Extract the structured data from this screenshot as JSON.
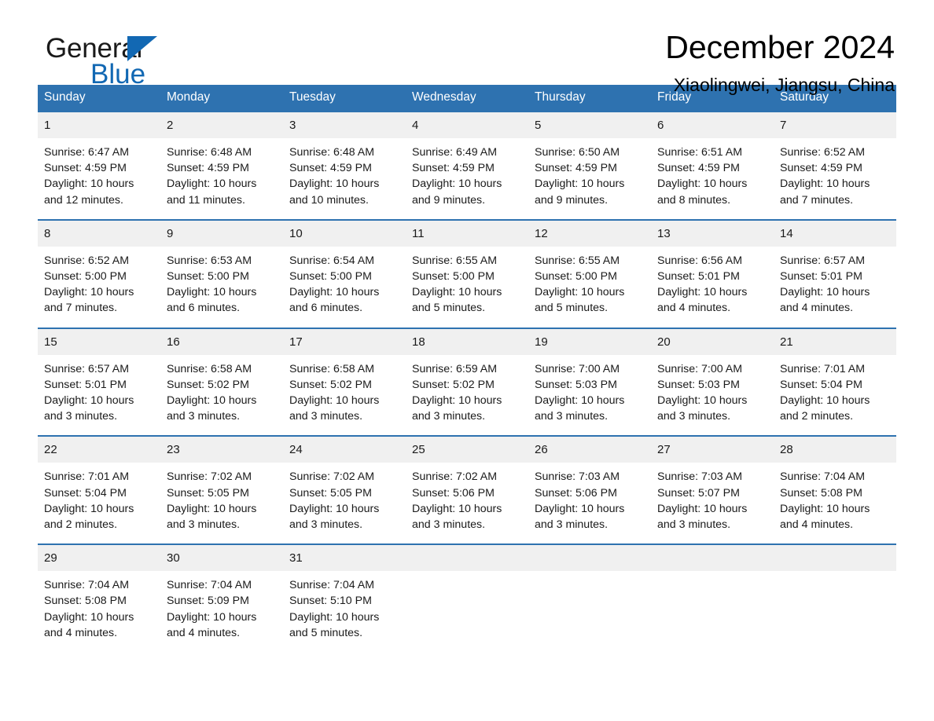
{
  "brand": {
    "name_part1": "General",
    "name_part2": "Blue",
    "logo_icon": "blue-triangle-icon",
    "accent_color": "#1268b3"
  },
  "header": {
    "title": "December 2024",
    "subtitle": "Xiaolingwei, Jiangsu, China"
  },
  "calendar": {
    "header_bg": "#2e72b0",
    "daynum_bg": "#f0f0f0",
    "weekday_headers": [
      "Sunday",
      "Monday",
      "Tuesday",
      "Wednesday",
      "Thursday",
      "Friday",
      "Saturday"
    ],
    "weeks": [
      [
        {
          "day": "1",
          "sunrise": "Sunrise: 6:47 AM",
          "sunset": "Sunset: 4:59 PM",
          "daylight_line1": "Daylight: 10 hours",
          "daylight_line2": "and 12 minutes."
        },
        {
          "day": "2",
          "sunrise": "Sunrise: 6:48 AM",
          "sunset": "Sunset: 4:59 PM",
          "daylight_line1": "Daylight: 10 hours",
          "daylight_line2": "and 11 minutes."
        },
        {
          "day": "3",
          "sunrise": "Sunrise: 6:48 AM",
          "sunset": "Sunset: 4:59 PM",
          "daylight_line1": "Daylight: 10 hours",
          "daylight_line2": "and 10 minutes."
        },
        {
          "day": "4",
          "sunrise": "Sunrise: 6:49 AM",
          "sunset": "Sunset: 4:59 PM",
          "daylight_line1": "Daylight: 10 hours",
          "daylight_line2": "and 9 minutes."
        },
        {
          "day": "5",
          "sunrise": "Sunrise: 6:50 AM",
          "sunset": "Sunset: 4:59 PM",
          "daylight_line1": "Daylight: 10 hours",
          "daylight_line2": "and 9 minutes."
        },
        {
          "day": "6",
          "sunrise": "Sunrise: 6:51 AM",
          "sunset": "Sunset: 4:59 PM",
          "daylight_line1": "Daylight: 10 hours",
          "daylight_line2": "and 8 minutes."
        },
        {
          "day": "7",
          "sunrise": "Sunrise: 6:52 AM",
          "sunset": "Sunset: 4:59 PM",
          "daylight_line1": "Daylight: 10 hours",
          "daylight_line2": "and 7 minutes."
        }
      ],
      [
        {
          "day": "8",
          "sunrise": "Sunrise: 6:52 AM",
          "sunset": "Sunset: 5:00 PM",
          "daylight_line1": "Daylight: 10 hours",
          "daylight_line2": "and 7 minutes."
        },
        {
          "day": "9",
          "sunrise": "Sunrise: 6:53 AM",
          "sunset": "Sunset: 5:00 PM",
          "daylight_line1": "Daylight: 10 hours",
          "daylight_line2": "and 6 minutes."
        },
        {
          "day": "10",
          "sunrise": "Sunrise: 6:54 AM",
          "sunset": "Sunset: 5:00 PM",
          "daylight_line1": "Daylight: 10 hours",
          "daylight_line2": "and 6 minutes."
        },
        {
          "day": "11",
          "sunrise": "Sunrise: 6:55 AM",
          "sunset": "Sunset: 5:00 PM",
          "daylight_line1": "Daylight: 10 hours",
          "daylight_line2": "and 5 minutes."
        },
        {
          "day": "12",
          "sunrise": "Sunrise: 6:55 AM",
          "sunset": "Sunset: 5:00 PM",
          "daylight_line1": "Daylight: 10 hours",
          "daylight_line2": "and 5 minutes."
        },
        {
          "day": "13",
          "sunrise": "Sunrise: 6:56 AM",
          "sunset": "Sunset: 5:01 PM",
          "daylight_line1": "Daylight: 10 hours",
          "daylight_line2": "and 4 minutes."
        },
        {
          "day": "14",
          "sunrise": "Sunrise: 6:57 AM",
          "sunset": "Sunset: 5:01 PM",
          "daylight_line1": "Daylight: 10 hours",
          "daylight_line2": "and 4 minutes."
        }
      ],
      [
        {
          "day": "15",
          "sunrise": "Sunrise: 6:57 AM",
          "sunset": "Sunset: 5:01 PM",
          "daylight_line1": "Daylight: 10 hours",
          "daylight_line2": "and 3 minutes."
        },
        {
          "day": "16",
          "sunrise": "Sunrise: 6:58 AM",
          "sunset": "Sunset: 5:02 PM",
          "daylight_line1": "Daylight: 10 hours",
          "daylight_line2": "and 3 minutes."
        },
        {
          "day": "17",
          "sunrise": "Sunrise: 6:58 AM",
          "sunset": "Sunset: 5:02 PM",
          "daylight_line1": "Daylight: 10 hours",
          "daylight_line2": "and 3 minutes."
        },
        {
          "day": "18",
          "sunrise": "Sunrise: 6:59 AM",
          "sunset": "Sunset: 5:02 PM",
          "daylight_line1": "Daylight: 10 hours",
          "daylight_line2": "and 3 minutes."
        },
        {
          "day": "19",
          "sunrise": "Sunrise: 7:00 AM",
          "sunset": "Sunset: 5:03 PM",
          "daylight_line1": "Daylight: 10 hours",
          "daylight_line2": "and 3 minutes."
        },
        {
          "day": "20",
          "sunrise": "Sunrise: 7:00 AM",
          "sunset": "Sunset: 5:03 PM",
          "daylight_line1": "Daylight: 10 hours",
          "daylight_line2": "and 3 minutes."
        },
        {
          "day": "21",
          "sunrise": "Sunrise: 7:01 AM",
          "sunset": "Sunset: 5:04 PM",
          "daylight_line1": "Daylight: 10 hours",
          "daylight_line2": "and 2 minutes."
        }
      ],
      [
        {
          "day": "22",
          "sunrise": "Sunrise: 7:01 AM",
          "sunset": "Sunset: 5:04 PM",
          "daylight_line1": "Daylight: 10 hours",
          "daylight_line2": "and 2 minutes."
        },
        {
          "day": "23",
          "sunrise": "Sunrise: 7:02 AM",
          "sunset": "Sunset: 5:05 PM",
          "daylight_line1": "Daylight: 10 hours",
          "daylight_line2": "and 3 minutes."
        },
        {
          "day": "24",
          "sunrise": "Sunrise: 7:02 AM",
          "sunset": "Sunset: 5:05 PM",
          "daylight_line1": "Daylight: 10 hours",
          "daylight_line2": "and 3 minutes."
        },
        {
          "day": "25",
          "sunrise": "Sunrise: 7:02 AM",
          "sunset": "Sunset: 5:06 PM",
          "daylight_line1": "Daylight: 10 hours",
          "daylight_line2": "and 3 minutes."
        },
        {
          "day": "26",
          "sunrise": "Sunrise: 7:03 AM",
          "sunset": "Sunset: 5:06 PM",
          "daylight_line1": "Daylight: 10 hours",
          "daylight_line2": "and 3 minutes."
        },
        {
          "day": "27",
          "sunrise": "Sunrise: 7:03 AM",
          "sunset": "Sunset: 5:07 PM",
          "daylight_line1": "Daylight: 10 hours",
          "daylight_line2": "and 3 minutes."
        },
        {
          "day": "28",
          "sunrise": "Sunrise: 7:04 AM",
          "sunset": "Sunset: 5:08 PM",
          "daylight_line1": "Daylight: 10 hours",
          "daylight_line2": "and 4 minutes."
        }
      ],
      [
        {
          "day": "29",
          "sunrise": "Sunrise: 7:04 AM",
          "sunset": "Sunset: 5:08 PM",
          "daylight_line1": "Daylight: 10 hours",
          "daylight_line2": "and 4 minutes."
        },
        {
          "day": "30",
          "sunrise": "Sunrise: 7:04 AM",
          "sunset": "Sunset: 5:09 PM",
          "daylight_line1": "Daylight: 10 hours",
          "daylight_line2": "and 4 minutes."
        },
        {
          "day": "31",
          "sunrise": "Sunrise: 7:04 AM",
          "sunset": "Sunset: 5:10 PM",
          "daylight_line1": "Daylight: 10 hours",
          "daylight_line2": "and 5 minutes."
        },
        {
          "day": "",
          "sunrise": "",
          "sunset": "",
          "daylight_line1": "",
          "daylight_line2": ""
        },
        {
          "day": "",
          "sunrise": "",
          "sunset": "",
          "daylight_line1": "",
          "daylight_line2": ""
        },
        {
          "day": "",
          "sunrise": "",
          "sunset": "",
          "daylight_line1": "",
          "daylight_line2": ""
        },
        {
          "day": "",
          "sunrise": "",
          "sunset": "",
          "daylight_line1": "",
          "daylight_line2": ""
        }
      ]
    ]
  }
}
